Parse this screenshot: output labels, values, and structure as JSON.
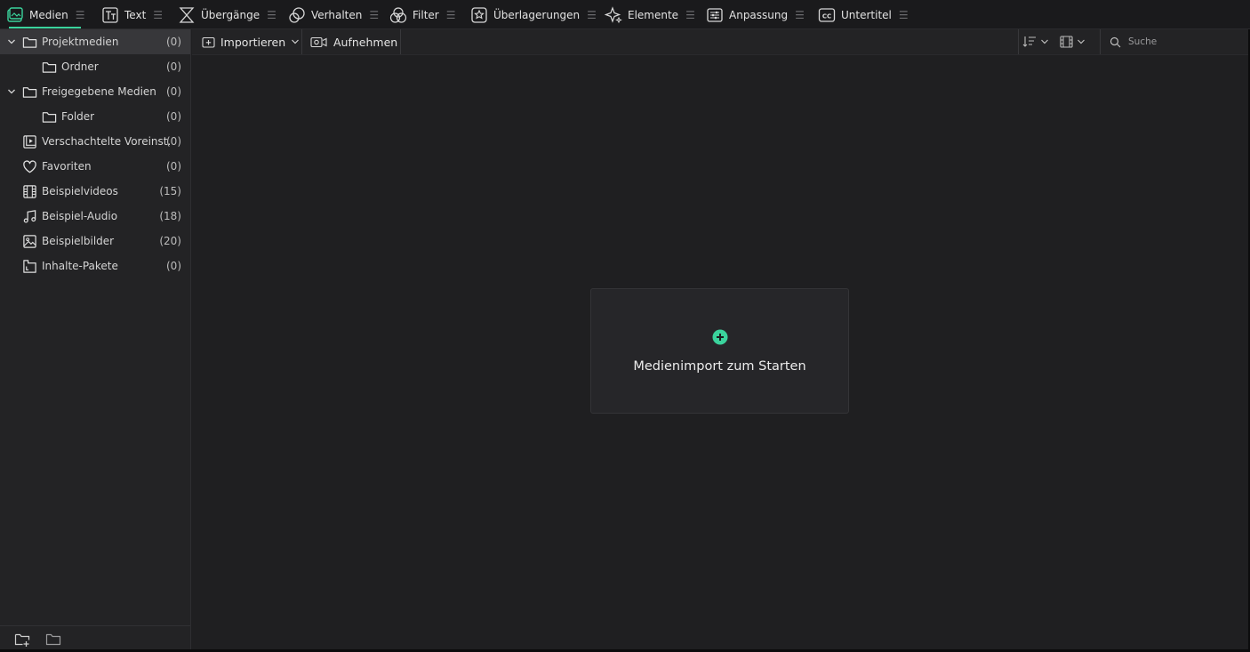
{
  "top_tabs": [
    {
      "label": "Medien",
      "icon": "media-icon",
      "active": true
    },
    {
      "label": "Text",
      "icon": "text-icon"
    },
    {
      "label": "Übergänge",
      "icon": "transitions-icon"
    },
    {
      "label": "Verhalten",
      "icon": "behaviors-icon"
    },
    {
      "label": "Filter",
      "icon": "filter-icon"
    },
    {
      "label": "Überlagerungen",
      "icon": "overlays-icon"
    },
    {
      "label": "Elemente",
      "icon": "elements-icon"
    },
    {
      "label": "Anpassung",
      "icon": "adjustment-icon"
    },
    {
      "label": "Untertitel",
      "icon": "subtitles-icon"
    }
  ],
  "sidebar": {
    "items": [
      {
        "label": "Projektmedien",
        "count": "(0)",
        "icon": "folder-icon",
        "expanded": true
      },
      {
        "label": "Ordner",
        "count": "(0)",
        "icon": "folder-icon"
      },
      {
        "label": "Freigegebene Medien",
        "count": "(0)",
        "icon": "folder-icon",
        "expanded": true
      },
      {
        "label": "Folder",
        "count": "(0)",
        "icon": "folder-icon"
      },
      {
        "label": "Verschachtelte Voreinst.",
        "count": "(0)",
        "icon": "nested-preset-icon"
      },
      {
        "label": "Favoriten",
        "count": "(0)",
        "icon": "heart-icon"
      },
      {
        "label": "Beispielvideos",
        "count": "(15)",
        "icon": "film-icon"
      },
      {
        "label": "Beispiel-Audio",
        "count": "(18)",
        "icon": "music-note-icon"
      },
      {
        "label": "Beispielbilder",
        "count": "(20)",
        "icon": "image-icon"
      },
      {
        "label": "Inhalte-Pakete",
        "count": "(0)",
        "icon": "package-icon"
      }
    ],
    "footer_icons": [
      "new-folder-icon",
      "folder-icon"
    ]
  },
  "toolbar": {
    "import_label": "Importieren",
    "record_label": "Aufnehmen",
    "search_placeholder": "Suche"
  },
  "main": {
    "import_card_text": "Medienimport zum Starten"
  },
  "colors": {
    "accent": "#3ad39c",
    "background": "#1f1f21",
    "sidebar": "#232325",
    "selected": "#37373a"
  }
}
